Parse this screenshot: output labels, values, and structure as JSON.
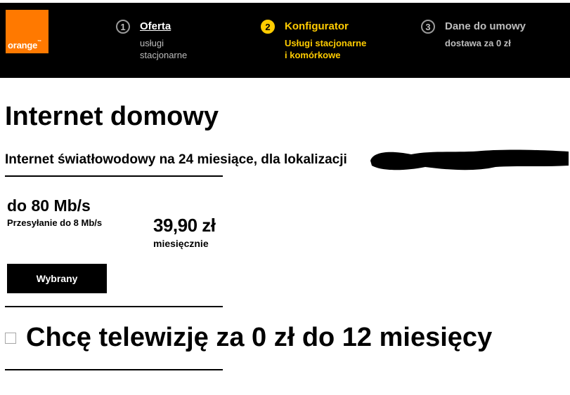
{
  "header": {
    "logo_text": "orange",
    "logo_tm": "™",
    "steps": [
      {
        "number": "1",
        "title": "Oferta",
        "subtitle": [
          "usługi",
          "stacjonarne"
        ]
      },
      {
        "number": "2",
        "title": "Konfigurator",
        "subtitle": [
          "Usługi stacjonarne",
          "i komórkowe"
        ]
      },
      {
        "number": "3",
        "title": "Dane do umowy",
        "subtitle": [
          "dostawa za 0 zł"
        ]
      }
    ]
  },
  "main": {
    "title": "Internet domowy",
    "offer_description": "Internet światłowodowy na 24 miesiące, dla lokalizacji",
    "plan": {
      "speed": "do 80 Mb/s",
      "upload": "Przesyłanie do 8 Mb/s",
      "price": "39,90 zł",
      "period": "miesięcznie",
      "selected_label": "Wybrany"
    },
    "tv_option": {
      "label": "Chcę telewizję za 0 zł do 12 miesięcy",
      "checked": false
    }
  },
  "colors": {
    "brand_orange": "#ff7900",
    "active_step": "#ffcc00",
    "header_bg": "#000000"
  }
}
